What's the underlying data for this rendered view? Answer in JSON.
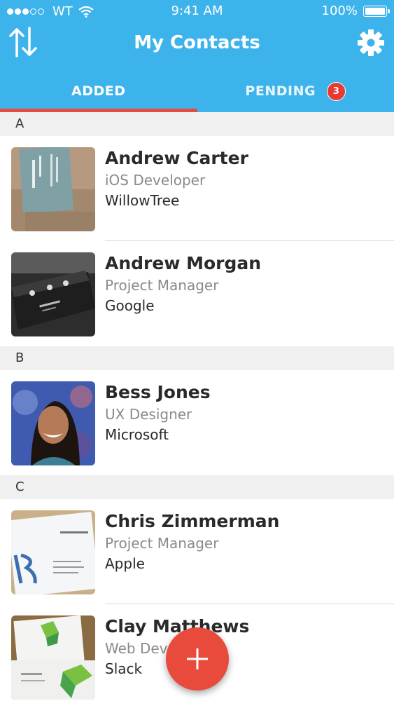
{
  "status_bar": {
    "carrier": "WT",
    "time": "9:41 AM",
    "battery": "100%"
  },
  "nav": {
    "title": "My Contacts",
    "left_icon": "sort-arrows-icon",
    "right_icon": "gear-icon"
  },
  "tabs": [
    {
      "label": "ADDED",
      "active": true
    },
    {
      "label": "PENDING",
      "badge": "3",
      "active": false
    }
  ],
  "sections": [
    {
      "letter": "A",
      "contacts": [
        {
          "name": "Andrew Carter",
          "title": "iOS Developer",
          "company": "WillowTree"
        },
        {
          "name": "Andrew Morgan",
          "title": "Project Manager",
          "company": "Google"
        }
      ]
    },
    {
      "letter": "B",
      "contacts": [
        {
          "name": "Bess Jones",
          "title": "UX Designer",
          "company": "Microsoft"
        }
      ]
    },
    {
      "letter": "C",
      "contacts": [
        {
          "name": "Chris Zimmerman",
          "title": "Project Manager",
          "company": "Apple"
        },
        {
          "name": "Clay Matthews",
          "title": "Web Developer",
          "company": "Slack"
        }
      ]
    }
  ],
  "fab": {
    "icon": "plus-icon"
  },
  "colors": {
    "header": "#3db3ec",
    "accent": "#e84a3c",
    "section_bg": "#f0f0f0"
  }
}
